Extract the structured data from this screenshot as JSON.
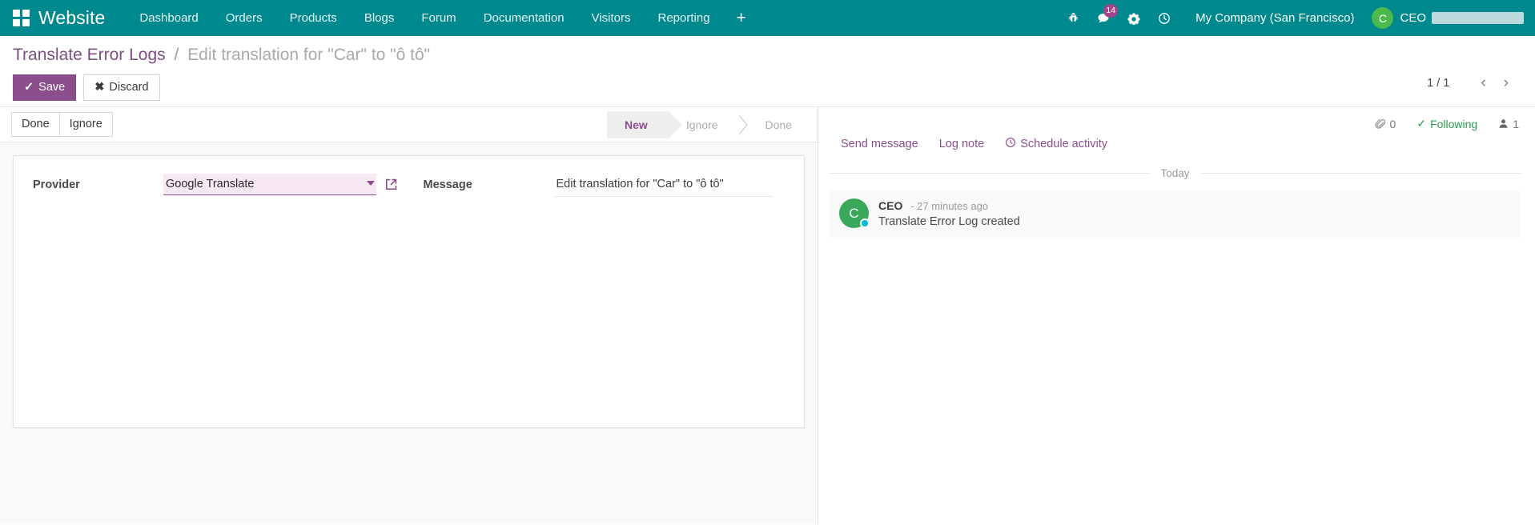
{
  "navbar": {
    "apps_icon": "apps-grid-icon",
    "brand": "Website",
    "menu_items": [
      {
        "label": "Dashboard"
      },
      {
        "label": "Orders"
      },
      {
        "label": "Products"
      },
      {
        "label": "Blogs"
      },
      {
        "label": "Forum"
      },
      {
        "label": "Documentation"
      },
      {
        "label": "Visitors"
      },
      {
        "label": "Reporting"
      }
    ],
    "plus_label": "+",
    "system_icons": [
      {
        "name": "bug-icon"
      },
      {
        "name": "messages-icon",
        "badge": "14"
      },
      {
        "name": "gear-icon"
      },
      {
        "name": "clock-icon"
      }
    ],
    "company": "My Company (San Francisco)",
    "user_initial": "C",
    "user_name": "CEO",
    "accent_color": "#00888f"
  },
  "control_panel": {
    "breadcrumb_root": "Translate Error Logs",
    "breadcrumb_sep": "/",
    "breadcrumb_current": "Edit translation for \"Car\" to \"ô tô\"",
    "save_label": "Save",
    "save_icon": "check-icon",
    "discard_label": "Discard",
    "discard_icon": "cross-icon",
    "pager_count": "1 / 1",
    "pager_prev": "‹",
    "pager_next": "›",
    "primary_color": "#8b4e8d"
  },
  "statusbar": {
    "buttons": [
      {
        "label": "Done"
      },
      {
        "label": "Ignore"
      }
    ],
    "stages": [
      {
        "label": "New",
        "active": true
      },
      {
        "label": "Ignore",
        "active": false
      },
      {
        "label": "Done",
        "active": false
      }
    ]
  },
  "form": {
    "provider": {
      "label": "Provider",
      "value": "Google Translate",
      "placeholder": "",
      "caret_icon": "chevron-down-icon",
      "external_icon": "external-link-icon"
    },
    "message": {
      "label": "Message",
      "value": "Edit translation for \"Car\" to \"ô tô\""
    }
  },
  "chatter": {
    "attachment_count": "0",
    "attachment_icon": "paperclip-icon",
    "following_label": "Following",
    "following_icon": "check-icon",
    "followers_count": "1",
    "followers_icon": "user-icon",
    "actions": [
      {
        "label": "Send message",
        "icon": ""
      },
      {
        "label": "Log note",
        "icon": ""
      },
      {
        "label": "Schedule activity",
        "icon": "clock-icon"
      }
    ],
    "date_separator": "Today",
    "messages": [
      {
        "author": "CEO",
        "author_initial": "C",
        "time": "- 27 minutes ago",
        "text": "Translate Error Log created"
      }
    ]
  }
}
